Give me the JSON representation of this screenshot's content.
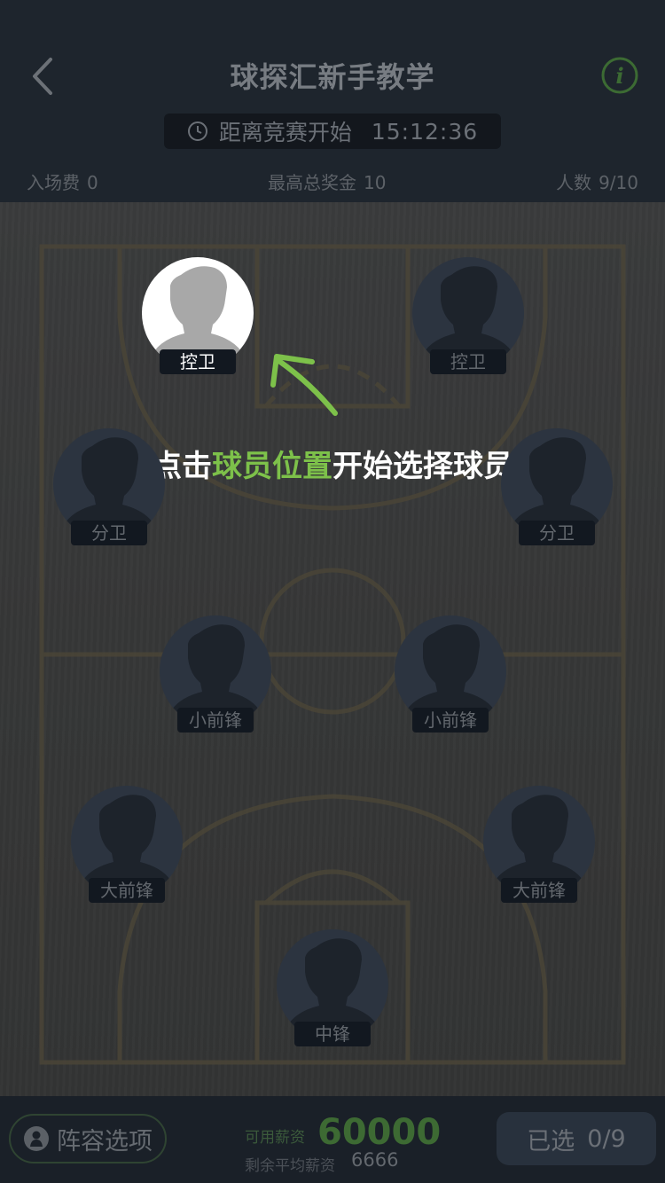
{
  "header": {
    "title": "球探汇新手教学",
    "countdown_label": "距离竞赛开始",
    "countdown_time": "15:12:36",
    "entry_fee_label": "入场费",
    "entry_fee_value": "0",
    "prize_label": "最高总奖金",
    "prize_value": "10",
    "players_label": "人数",
    "players_value": "9/10"
  },
  "hint": {
    "prefix": "点击",
    "highlight": "球员位置",
    "suffix": "开始选择球员"
  },
  "positions": [
    {
      "label": "控卫",
      "active": true
    },
    {
      "label": "控卫",
      "active": false
    },
    {
      "label": "分卫",
      "active": false
    },
    {
      "label": "分卫",
      "active": false
    },
    {
      "label": "小前锋",
      "active": false
    },
    {
      "label": "小前锋",
      "active": false
    },
    {
      "label": "大前锋",
      "active": false
    },
    {
      "label": "大前锋",
      "active": false
    },
    {
      "label": "中锋",
      "active": false
    }
  ],
  "footer": {
    "lineup_button": "阵容选项",
    "available_salary_label": "可用薪资",
    "available_salary_value": "60000",
    "avg_salary_label": "剩余平均薪资",
    "avg_salary_value": "6666",
    "selected_label": "已选",
    "selected_value": "0/9"
  },
  "colors": {
    "accent_green": "#7dc14a",
    "header_bg": "#1e252d",
    "label_bg": "#121820"
  },
  "icons": [
    "chevron-left-icon",
    "info-icon",
    "clock-icon",
    "player-silhouette-icon",
    "person-icon",
    "arrow-icon"
  ]
}
